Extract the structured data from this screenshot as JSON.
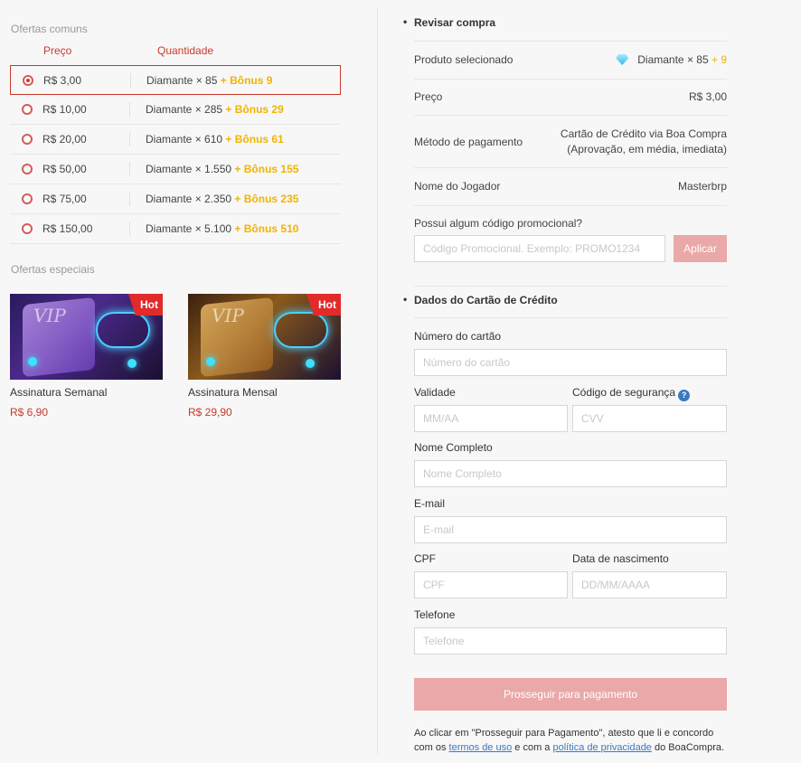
{
  "common_offers": {
    "title": "Ofertas comuns",
    "col_price": "Preço",
    "col_quantity": "Quantidade",
    "rows": [
      {
        "price": "R$ 3,00",
        "qty": "Diamante × 85",
        "bonus": "+ Bônus 9",
        "selected": true
      },
      {
        "price": "R$ 10,00",
        "qty": "Diamante × 285",
        "bonus": "+ Bônus 29"
      },
      {
        "price": "R$ 20,00",
        "qty": "Diamante × 610",
        "bonus": "+ Bônus 61"
      },
      {
        "price": "R$ 50,00",
        "qty": "Diamante × 1.550",
        "bonus": "+ Bônus 155"
      },
      {
        "price": "R$ 75,00",
        "qty": "Diamante × 2.350",
        "bonus": "+ Bônus 235"
      },
      {
        "price": "R$ 150,00",
        "qty": "Diamante × 5.100",
        "bonus": "+ Bônus 510"
      }
    ]
  },
  "special_offers": {
    "title": "Ofertas especiais",
    "cards": [
      {
        "badge": "Hot",
        "name": "Assinatura Semanal",
        "price": "R$ 6,90",
        "image_text": "VIP"
      },
      {
        "badge": "Hot",
        "name": "Assinatura Mensal",
        "price": "R$ 29,90",
        "image_text": "VIP"
      }
    ]
  },
  "review": {
    "title": "Revisar compra",
    "product_label": "Produto selecionado",
    "product_value": "Diamante × 85",
    "product_bonus": "+ 9",
    "price_label": "Preço",
    "price_value": "R$ 3,00",
    "method_label": "Método de pagamento",
    "method_line1": "Cartão de Crédito via Boa Compra",
    "method_line2": "(Aprovação, em média, imediata)",
    "player_label": "Nome do Jogador",
    "player_value": "Masterbrp",
    "promo_question": "Possui algum código promocional?",
    "promo_placeholder": "Código Promocional. Exemplo: PROMO1234",
    "apply_label": "Aplicar"
  },
  "card_form": {
    "title": "Dados do Cartão de Crédito",
    "card_number_label": "Número do cartão",
    "card_number_placeholder": "Número do cartão",
    "expiry_label": "Validade",
    "expiry_placeholder": "MM/AA",
    "cvv_label": "Código de segurança",
    "cvv_info": "?",
    "cvv_placeholder": "CVV",
    "name_label": "Nome Completo",
    "name_placeholder": "Nome Completo",
    "email_label": "E-mail",
    "email_placeholder": "E-mail",
    "cpf_label": "CPF",
    "cpf_placeholder": "CPF",
    "birth_label": "Data de nascimento",
    "birth_placeholder": "DD/MM/AAAA",
    "phone_label": "Telefone",
    "phone_placeholder": "Telefone",
    "submit_label": "Prosseguir para pagamento"
  },
  "terms": {
    "pre": "Ao clicar em \"Prosseguir para Pagamento\", atesto que li e concordo com os ",
    "terms_link": "termos de uso",
    "mid": " e com a ",
    "privacy_link": "política de privacidade",
    "post": " do BoaCompra."
  },
  "colors": {
    "accent": "#c8392b",
    "bonus": "#f0b400",
    "button": "#eaa8a8",
    "link": "#3a78c3"
  }
}
